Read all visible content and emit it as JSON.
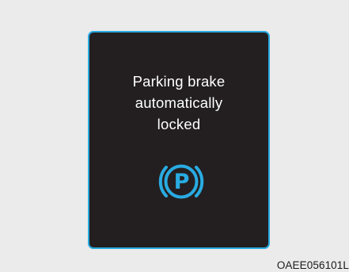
{
  "colors": {
    "background": "#ebebeb",
    "panel": "#231f20",
    "panel_border": "#29abe2",
    "message_text": "#ffffff",
    "icon": "#29abe2",
    "caption": "#1a1a1a"
  },
  "cluster_display": {
    "message_lines": [
      "Parking brake",
      "automatically",
      "locked"
    ],
    "icon": {
      "name": "parking-brake-icon",
      "glyph": "P"
    }
  },
  "image_code": "OAEE056101L"
}
